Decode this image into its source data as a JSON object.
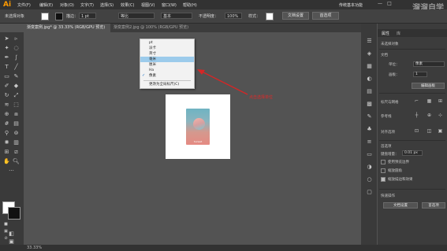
{
  "app": {
    "logo": "Ai",
    "menus": [
      "文件(F)",
      "编辑(E)",
      "对象(O)",
      "文字(T)",
      "选择(S)",
      "效果(C)",
      "视图(V)",
      "窗口(W)",
      "帮助(H)"
    ],
    "workspace": "传统基本功能",
    "watermark": "溜溜自学",
    "window_buttons": [
      "—",
      "□",
      "✕"
    ]
  },
  "controlbar": {
    "selection_label": "未选择对象",
    "stroke_label": "描边：",
    "stroke_weight": "1 pt",
    "stroke_style": "等比",
    "brush": "基本",
    "opacity_label": "不透明度：",
    "opacity_value": "100%",
    "style_label": "样式：",
    "doc_setup_button": "文档设置",
    "preferences_button": "首选项"
  },
  "tabs": [
    {
      "label": "渐变案例.jpg* @ 33.33% (RGB/GPU 预览)",
      "active": true
    },
    {
      "label": "渐变案例2.jpg @ 100% (RGB/GPU 预览)",
      "active": false
    }
  ],
  "dropdown": {
    "items": [
      {
        "label": "pt",
        "selected": false,
        "checked": false
      },
      {
        "label": "派卡",
        "selected": false,
        "checked": false
      },
      {
        "label": "英寸",
        "selected": false,
        "checked": false
      },
      {
        "label": "毫米",
        "selected": true,
        "checked": false
      },
      {
        "label": "厘米",
        "selected": false,
        "checked": false
      },
      {
        "label": "Ha",
        "selected": false,
        "checked": false
      },
      {
        "label": "像素",
        "selected": false,
        "checked": true
      },
      {
        "label": "更改为全局标尺(C)",
        "selected": false,
        "checked": false
      }
    ],
    "check_glyph": "✓"
  },
  "annotation": {
    "text": "点击选择单位",
    "color": "#e42828"
  },
  "artwork": {
    "caption": "Sunset"
  },
  "panel": {
    "tabs": [
      "属性",
      "库"
    ],
    "selection_state": "未选择对象",
    "document_section": "文档",
    "units_label": "单位：",
    "units_value": "像素",
    "artboard_label": "画板：",
    "artboard_value": "1",
    "edit_artboard_button": "编辑画板",
    "ruler_grid_section": "标尺与网格",
    "guides_section": "参考线",
    "align_section": "对齐选项",
    "preferences_section": "首选项",
    "keyboard_increment_label": "键盘增量：",
    "keyboard_increment_value": "0.01 px",
    "checkbox_1": "使用预览边界",
    "checkbox_2": "缩放圆角",
    "checkbox_3": "缩放描边和效果",
    "quick_actions_section": "快速操作",
    "doc_setup_button": "文档设置",
    "preferences_button": "首选项"
  },
  "status": {
    "zoom": "33.33%"
  },
  "colors": {
    "accent": "#ff9a00",
    "annotation": "#e42828",
    "dropdown_highlight": "#9ccbeb"
  }
}
